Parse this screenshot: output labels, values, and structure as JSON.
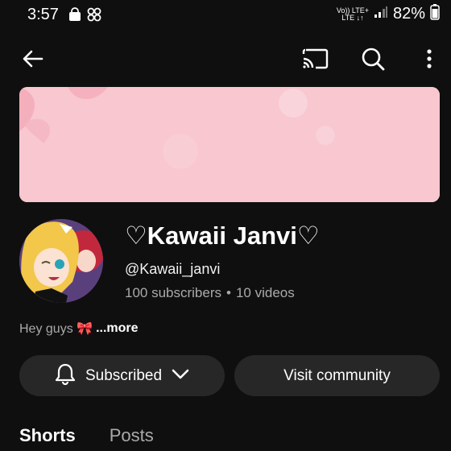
{
  "status_bar": {
    "time": "3:57",
    "net_top": "Vo)) LTE+",
    "net_bottom": "LTE ↓↑",
    "battery": "82%"
  },
  "top_bar": {
    "icons": [
      "back-arrow-icon",
      "cast-icon",
      "search-icon",
      "more-vert-icon"
    ]
  },
  "channel": {
    "name": "♡Kawaii Janvi♡",
    "handle": "@Kawaii_janvi",
    "subscribers": "100 subscribers",
    "separator": "•",
    "videos": "10 videos",
    "description": "Hey guys 🎀",
    "more": "...more"
  },
  "actions": {
    "subscribed": "Subscribed",
    "visit_community": "Visit community"
  },
  "tabs": [
    {
      "label": "Shorts",
      "active": true
    },
    {
      "label": "Posts",
      "active": false
    }
  ],
  "colors": {
    "background": "#0f0f0f",
    "button_bg": "#272727",
    "banner": "#f8c7cf",
    "secondary_text": "#aaaaaa"
  }
}
